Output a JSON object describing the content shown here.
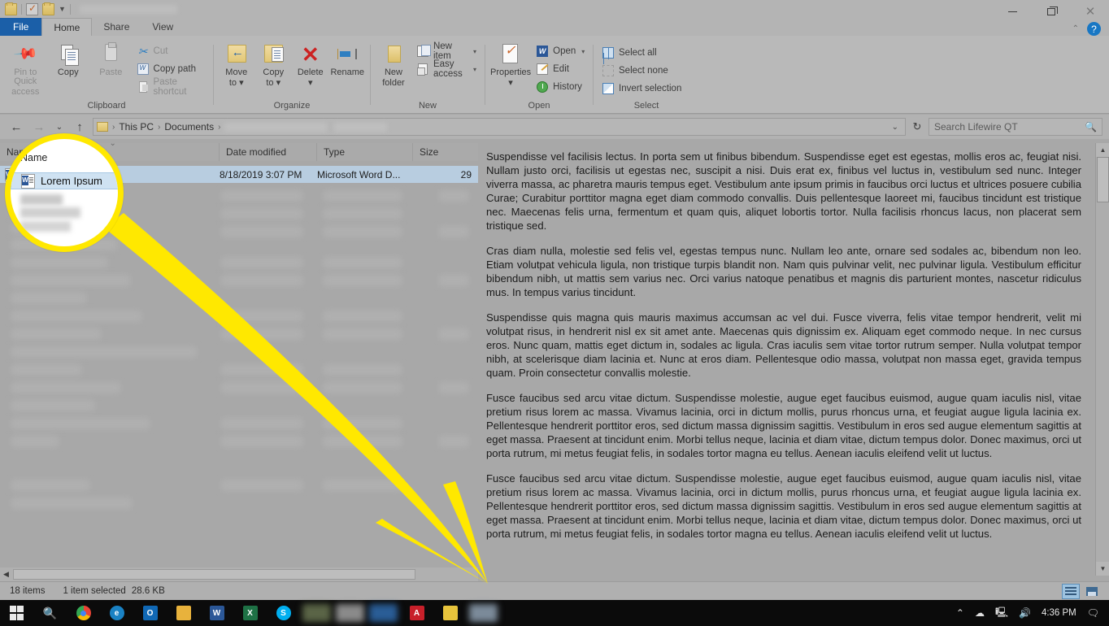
{
  "window": {
    "quick_access": {
      "items": [
        "folder-icon",
        "properties-icon",
        "new-folder-icon",
        "customize-caret-icon"
      ],
      "title_redacted": true
    },
    "controls": {
      "minimize": "—",
      "maximize": "❐",
      "close": "✕",
      "help": "?",
      "collapse_ribbon": "⌃"
    }
  },
  "tabs": [
    {
      "label": "File",
      "type": "file"
    },
    {
      "label": "Home",
      "type": "active"
    },
    {
      "label": "Share",
      "type": "normal"
    },
    {
      "label": "View",
      "type": "normal"
    }
  ],
  "ribbon": {
    "groups": [
      {
        "name": "Clipboard",
        "label": "Clipboard",
        "big_buttons": [
          {
            "label": "Pin to Quick\naccess",
            "line1": "Pin to Quick",
            "line2": "access",
            "icon": "pin-icon",
            "disabled": true
          },
          {
            "label": "Copy",
            "line1": "Copy",
            "line2": "",
            "icon": "copy-icon",
            "disabled": false
          },
          {
            "label": "Paste",
            "line1": "Paste",
            "line2": "",
            "icon": "paste-icon",
            "disabled": true
          }
        ],
        "small_buttons": [
          {
            "label": "Cut",
            "icon": "scissors-icon",
            "disabled": true
          },
          {
            "label": "Copy path",
            "icon": "copy-path-icon",
            "disabled": false
          },
          {
            "label": "Paste shortcut",
            "icon": "paste-shortcut-icon",
            "disabled": true
          }
        ]
      },
      {
        "name": "Organize",
        "label": "Organize",
        "big_buttons": [
          {
            "line1": "Move",
            "line2": "to ▾",
            "icon": "move-to-icon",
            "disabled": false
          },
          {
            "line1": "Copy",
            "line2": "to ▾",
            "icon": "copy-to-icon",
            "disabled": false
          },
          {
            "line1": "Delete",
            "line2": "▾",
            "icon": "delete-icon",
            "disabled": false
          },
          {
            "line1": "Rename",
            "line2": "",
            "icon": "rename-icon",
            "disabled": false
          }
        ],
        "small_buttons": []
      },
      {
        "name": "New",
        "label": "New",
        "big_buttons": [
          {
            "line1": "New",
            "line2": "folder",
            "icon": "new-folder-icon",
            "disabled": false
          }
        ],
        "small_buttons": [
          {
            "label": "New item",
            "icon": "new-item-icon",
            "caret": "▾",
            "disabled": false
          },
          {
            "label": "Easy access",
            "icon": "easy-access-icon",
            "caret": "▾",
            "disabled": false
          }
        ]
      },
      {
        "name": "Open",
        "label": "Open",
        "big_buttons": [
          {
            "line1": "Properties",
            "line2": "▾",
            "icon": "properties-icon",
            "disabled": false
          }
        ],
        "small_buttons": [
          {
            "label": "Open",
            "icon": "word-open-icon",
            "caret": "▾",
            "disabled": false
          },
          {
            "label": "Edit",
            "icon": "edit-icon",
            "disabled": false
          },
          {
            "label": "History",
            "icon": "history-icon",
            "disabled": false
          }
        ]
      },
      {
        "name": "Select",
        "label": "Select",
        "big_buttons": [],
        "small_buttons": [
          {
            "label": "Select all",
            "icon": "select-all-icon",
            "disabled": false
          },
          {
            "label": "Select none",
            "icon": "select-none-icon",
            "disabled": false
          },
          {
            "label": "Invert selection",
            "icon": "invert-selection-icon",
            "disabled": false
          }
        ]
      }
    ]
  },
  "address_bar": {
    "back": "←",
    "forward": "→",
    "recent": "⌄",
    "up": "↑",
    "breadcrumbs": [
      "This PC",
      "Documents"
    ],
    "redacted_crumbs": 2,
    "dropdown": "⌄",
    "refresh": "↻",
    "search_placeholder": "Search Lifewire QT",
    "search_value": "",
    "search_icon": "search-icon"
  },
  "file_list": {
    "columns": [
      {
        "key": "name",
        "label": "Name",
        "sorted": true
      },
      {
        "key": "date",
        "label": "Date modified",
        "sorted": false
      },
      {
        "key": "type",
        "label": "Type",
        "sorted": false
      },
      {
        "key": "size",
        "label": "Size",
        "sorted": false
      }
    ],
    "selected_row": {
      "name": "Lorem Ipsum",
      "date": "8/18/2019 3:07 PM",
      "type": "Microsoft Word D...",
      "size": "29",
      "icon": "word-document-icon"
    },
    "redacted_rows_note": "blurred"
  },
  "callout": {
    "magnifier_label": "Name",
    "magnifier_file": "Lorem Ipsum",
    "arrow_color": "#FFE800",
    "circle_color": "#FFE800"
  },
  "preview": {
    "paragraphs": [
      "Suspendisse vel facilisis lectus. In porta sem ut finibus bibendum. Suspendisse eget est egestas, mollis eros ac, feugiat nisi. Nullam justo orci, facilisis ut egestas nec, suscipit a nisi. Duis erat ex, finibus vel luctus in, vestibulum sed nunc. Integer viverra massa, ac pharetra mauris tempus eget. Vestibulum ante ipsum primis in faucibus orci luctus et ultrices posuere cubilia Curae; Curabitur porttitor magna eget diam commodo convallis. Duis pellentesque laoreet mi, faucibus tincidunt est tristique nec. Maecenas felis urna, fermentum et quam quis, aliquet lobortis tortor. Nulla facilisis rhoncus lacus, non placerat sem tristique sed.",
      "Cras diam nulla, molestie sed felis vel, egestas tempus nunc. Nullam leo ante, ornare sed sodales ac, bibendum non leo. Etiam volutpat vehicula ligula, non tristique turpis blandit non. Nam quis pulvinar velit, nec pulvinar ligula. Vestibulum efficitur bibendum nibh, ut mattis sem varius nec. Orci varius natoque penatibus et magnis dis parturient montes, nascetur ridiculus mus. In tempus varius tincidunt.",
      "Suspendisse quis magna quis mauris maximus accumsan ac vel dui. Fusce viverra, felis vitae tempor hendrerit, velit mi volutpat risus, in hendrerit nisl ex sit amet ante. Maecenas quis dignissim ex. Aliquam eget commodo neque. In nec cursus eros. Nunc quam, mattis eget dictum in, sodales ac ligula. Cras iaculis sem vitae tortor rutrum semper. Nulla volutpat tempor nibh, at scelerisque diam lacinia et. Nunc at eros diam. Pellentesque odio massa, volutpat non massa eget, gravida tempus quam. Proin consectetur convallis molestie.",
      "Fusce faucibus sed arcu vitae dictum. Suspendisse molestie, augue eget faucibus euismod, augue quam iaculis nisl, vitae pretium risus lorem ac massa. Vivamus lacinia, orci in dictum mollis, purus rhoncus urna, et feugiat augue ligula lacinia ex. Pellentesque hendrerit porttitor eros, sed dictum massa dignissim sagittis. Vestibulum in eros sed augue elementum sagittis at eget massa. Praesent at tincidunt enim. Morbi tellus neque, lacinia et diam vitae, dictum tempus dolor. Donec maximus, orci ut porta rutrum, mi metus feugiat felis, in sodales tortor magna eu tellus. Aenean iaculis eleifend velit ut luctus.",
      "Fusce faucibus sed arcu vitae dictum. Suspendisse molestie, augue eget faucibus euismod, augue quam iaculis nisl, vitae pretium risus lorem ac massa. Vivamus lacinia, orci in dictum mollis, purus rhoncus urna, et feugiat augue ligula lacinia ex. Pellentesque hendrerit porttitor eros, sed dictum massa dignissim sagittis. Vestibulum in eros sed augue elementum sagittis at eget massa. Praesent at tincidunt enim. Morbi tellus neque, lacinia et diam vitae, dictum tempus dolor. Donec maximus, orci ut porta rutrum, mi metus feugiat felis, in sodales tortor magna eu tellus. Aenean iaculis eleifend velit ut luctus."
    ],
    "scroll_up": "▲",
    "scroll_down": "▼"
  },
  "status_bar": {
    "item_count": "18 items",
    "selection": "1 item selected",
    "selection_size": "28.6 KB",
    "view_details": "details-view-icon",
    "view_large_icons": "large-icons-view-icon"
  },
  "taskbar": {
    "start": "start-button-icon",
    "search": "search-icon",
    "apps": [
      {
        "name": "chrome-icon",
        "label": "",
        "color": "#d8d8d8"
      },
      {
        "name": "edge-icon",
        "label": "e",
        "color": "#1a82c4"
      },
      {
        "name": "outlook-icon",
        "label": "O",
        "color": "#1068b5"
      },
      {
        "name": "file-explorer-icon",
        "label": "",
        "color": "#e8b23c"
      },
      {
        "name": "word-icon",
        "label": "W",
        "color": "#2b5797"
      },
      {
        "name": "excel-icon",
        "label": "X",
        "color": "#1e7145"
      },
      {
        "name": "skype-icon",
        "label": "S",
        "color": "#00aff0"
      },
      {
        "name": "redacted-app-icon-1",
        "label": "",
        "color": "#5a6446"
      },
      {
        "name": "redacted-app-icon-2",
        "label": "",
        "color": "#8a8a8a"
      },
      {
        "name": "redacted-app-icon-3",
        "label": "",
        "color": "#2a5d96"
      },
      {
        "name": "acrobat-icon",
        "label": "A",
        "color": "#c8202a"
      },
      {
        "name": "sticky-notes-icon",
        "label": "",
        "color": "#e8c43c"
      },
      {
        "name": "redacted-app-icon-4",
        "label": "",
        "color": "#7b8a99"
      }
    ],
    "tray": {
      "chevron": "⌃",
      "onedrive": "onedrive-icon",
      "network": "network-icon",
      "volume": "volume-icon",
      "time": "4:36 PM",
      "action_center": "action-center-icon"
    }
  }
}
